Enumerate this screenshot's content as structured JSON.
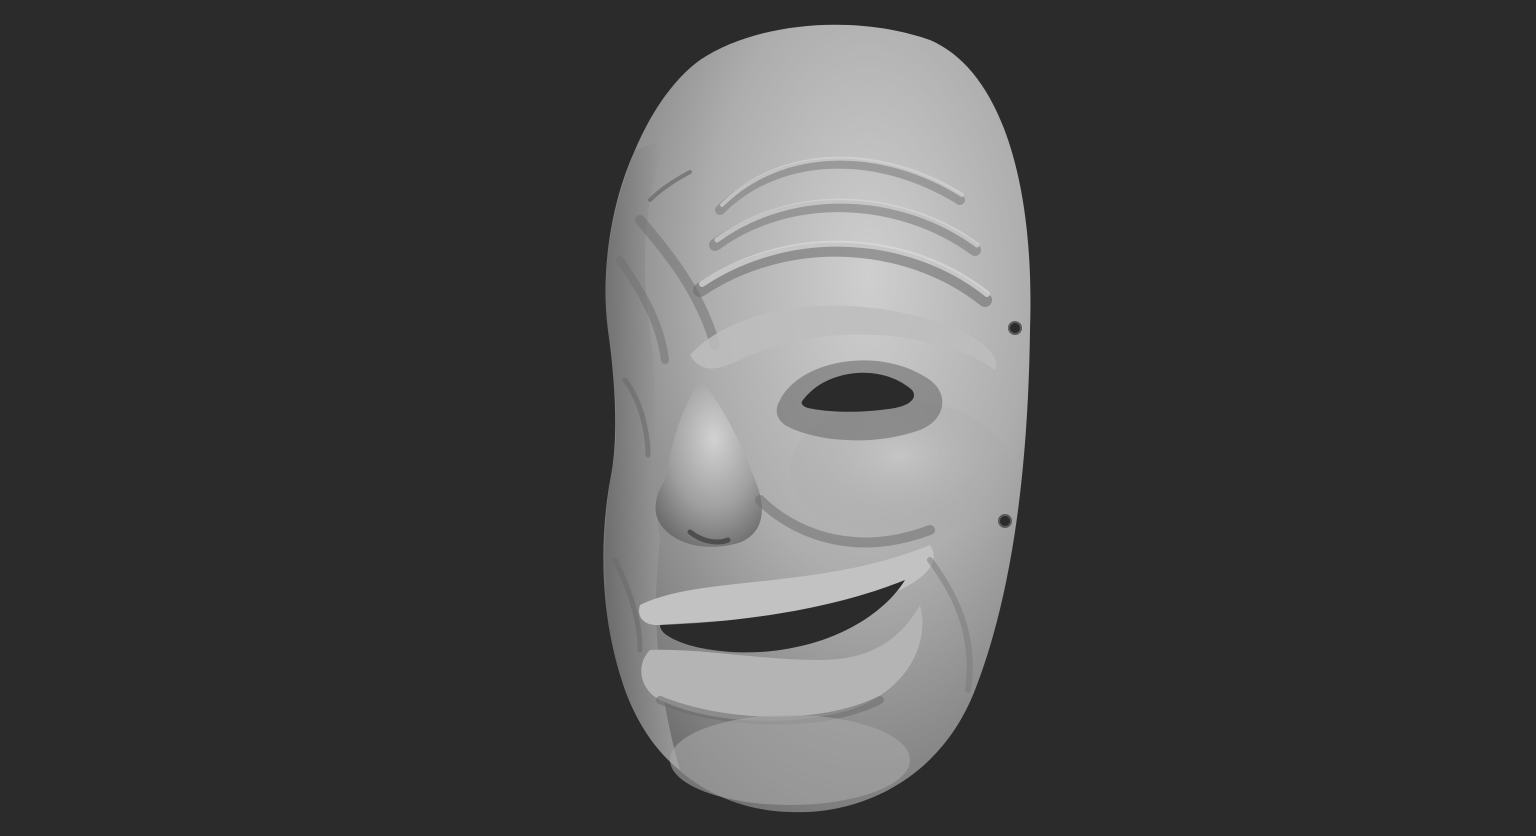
{
  "scene": {
    "subject": "sculpted-mask-render",
    "background_color": "#2b2b2b",
    "mask_base_color": "#a3a3a3",
    "mask_highlight_color": "#cfcfcf",
    "mask_shadow_color": "#4a4a4a",
    "hole_color": "#2b2b2b"
  }
}
